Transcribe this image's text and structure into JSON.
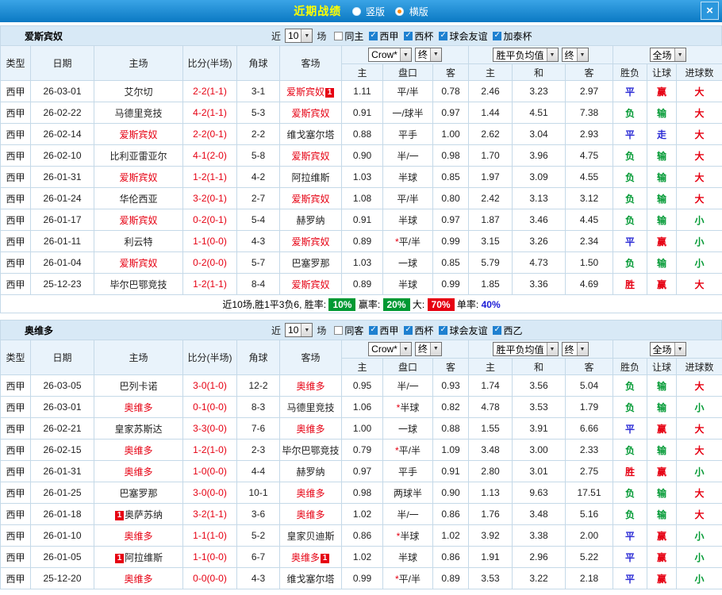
{
  "titlebar": {
    "title": "近期战绩",
    "layout_options": [
      {
        "label": "竖版",
        "selected": false
      },
      {
        "label": "横版",
        "selected": true
      }
    ],
    "close_label": "×"
  },
  "colors": {
    "accent_red": "#e60012",
    "accent_green": "#009933",
    "accent_blue": "#2b2bd5",
    "value_colors": {
      "胜": "#e60012",
      "平": "#2b2bd5",
      "负": "#009933",
      "赢": "#e60012",
      "输": "#009933",
      "走": "#2b2bd5",
      "大": "#e60012",
      "小": "#009933"
    }
  },
  "table_headers": {
    "left": [
      "类型",
      "日期",
      "主场",
      "比分(半场)",
      "角球",
      "客场"
    ],
    "odds_sub": [
      "主",
      "盘口",
      "客"
    ],
    "europe_sub": [
      "主",
      "和",
      "客"
    ],
    "result_sub": [
      "胜负",
      "让球",
      "进球数"
    ]
  },
  "sections": [
    {
      "team": "爱斯宾奴",
      "filter": {
        "near": "近",
        "count": "10",
        "unit": "场",
        "checkboxes": [
          {
            "label": "同主",
            "checked": false
          },
          {
            "label": "西甲",
            "checked": true
          },
          {
            "label": "西杯",
            "checked": true
          },
          {
            "label": "球会友谊",
            "checked": true
          },
          {
            "label": "加泰杯",
            "checked": true
          }
        ]
      },
      "selects": {
        "odds": "Crow*",
        "odds_stage": "终",
        "europe": "胜平负均值",
        "europe_stage": "终",
        "scope": "全场"
      },
      "rows": [
        {
          "league": "西甲",
          "date": "26-03-01",
          "home": "艾尔切",
          "home_badge": "",
          "score": "2-2(1-1)",
          "corner": "3-1",
          "away": "爱斯宾奴",
          "away_badge": "1",
          "odds": [
            "1.11",
            "平/半",
            "0.78"
          ],
          "europe": [
            "2.46",
            "3.23",
            "2.97"
          ],
          "result": [
            "平",
            "赢",
            "大"
          ]
        },
        {
          "league": "西甲",
          "date": "26-02-22",
          "home": "马德里竞技",
          "home_badge": "",
          "score": "4-2(1-1)",
          "corner": "5-3",
          "away": "爱斯宾奴",
          "away_badge": "",
          "odds": [
            "0.91",
            "一/球半",
            "0.97"
          ],
          "europe": [
            "1.44",
            "4.51",
            "7.38"
          ],
          "result": [
            "负",
            "输",
            "大"
          ]
        },
        {
          "league": "西甲",
          "date": "26-02-14",
          "home": "爱斯宾奴",
          "home_badge": "",
          "score": "2-2(0-1)",
          "corner": "2-2",
          "away": "维戈塞尔塔",
          "away_badge": "",
          "odds": [
            "0.88",
            "平手",
            "1.00"
          ],
          "europe": [
            "2.62",
            "3.04",
            "2.93"
          ],
          "result": [
            "平",
            "走",
            "大"
          ]
        },
        {
          "league": "西甲",
          "date": "26-02-10",
          "home": "比利亚雷亚尔",
          "home_badge": "",
          "score": "4-1(2-0)",
          "corner": "5-8",
          "away": "爱斯宾奴",
          "away_badge": "",
          "odds": [
            "0.90",
            "半/一",
            "0.98"
          ],
          "europe": [
            "1.70",
            "3.96",
            "4.75"
          ],
          "result": [
            "负",
            "输",
            "大"
          ]
        },
        {
          "league": "西甲",
          "date": "26-01-31",
          "home": "爱斯宾奴",
          "home_badge": "",
          "score": "1-2(1-1)",
          "corner": "4-2",
          "away": "阿拉维斯",
          "away_badge": "",
          "odds": [
            "1.03",
            "半球",
            "0.85"
          ],
          "europe": [
            "1.97",
            "3.09",
            "4.55"
          ],
          "result": [
            "负",
            "输",
            "大"
          ]
        },
        {
          "league": "西甲",
          "date": "26-01-24",
          "home": "华伦西亚",
          "home_badge": "",
          "score": "3-2(0-1)",
          "corner": "2-7",
          "away": "爱斯宾奴",
          "away_badge": "",
          "odds": [
            "1.08",
            "平/半",
            "0.80"
          ],
          "europe": [
            "2.42",
            "3.13",
            "3.12"
          ],
          "result": [
            "负",
            "输",
            "大"
          ]
        },
        {
          "league": "西甲",
          "date": "26-01-17",
          "home": "爱斯宾奴",
          "home_badge": "",
          "score": "0-2(0-1)",
          "corner": "5-4",
          "away": "赫罗纳",
          "away_badge": "",
          "odds": [
            "0.91",
            "半球",
            "0.97"
          ],
          "europe": [
            "1.87",
            "3.46",
            "4.45"
          ],
          "result": [
            "负",
            "输",
            "小"
          ]
        },
        {
          "league": "西甲",
          "date": "26-01-11",
          "home": "利云特",
          "home_badge": "",
          "score": "1-1(0-0)",
          "corner": "4-3",
          "away": "爱斯宾奴",
          "away_badge": "",
          "odds": [
            "0.89",
            "*平/半",
            "0.99"
          ],
          "europe": [
            "3.15",
            "3.26",
            "2.34"
          ],
          "result": [
            "平",
            "赢",
            "小"
          ]
        },
        {
          "league": "西甲",
          "date": "26-01-04",
          "home": "爱斯宾奴",
          "home_badge": "",
          "score": "0-2(0-0)",
          "corner": "5-7",
          "away": "巴塞罗那",
          "away_badge": "",
          "odds": [
            "1.03",
            "一球",
            "0.85"
          ],
          "europe": [
            "5.79",
            "4.73",
            "1.50"
          ],
          "result": [
            "负",
            "输",
            "小"
          ]
        },
        {
          "league": "西甲",
          "date": "25-12-23",
          "home": "毕尔巴鄂竞技",
          "home_badge": "",
          "score": "1-2(1-1)",
          "corner": "8-4",
          "away": "爱斯宾奴",
          "away_badge": "",
          "odds": [
            "0.89",
            "半球",
            "0.99"
          ],
          "europe": [
            "1.85",
            "3.36",
            "4.69"
          ],
          "result": [
            "胜",
            "赢",
            "大"
          ]
        }
      ],
      "summary": {
        "prefix": "近10场,胜1平3负6,",
        "items": [
          {
            "label": "胜率:",
            "value": "10%",
            "bg": "#009933"
          },
          {
            "label": "赢率:",
            "value": "20%",
            "bg": "#009933"
          },
          {
            "label": "大:",
            "value": "70%",
            "bg": "#e60012"
          },
          {
            "label": "单率:",
            "value": "40%",
            "bg": ""
          }
        ]
      }
    },
    {
      "team": "奥维多",
      "filter": {
        "near": "近",
        "count": "10",
        "unit": "场",
        "checkboxes": [
          {
            "label": "同客",
            "checked": false
          },
          {
            "label": "西甲",
            "checked": true
          },
          {
            "label": "西杯",
            "checked": true
          },
          {
            "label": "球会友谊",
            "checked": true
          },
          {
            "label": "西乙",
            "checked": true
          }
        ]
      },
      "selects": {
        "odds": "Crow*",
        "odds_stage": "终",
        "europe": "胜平负均值",
        "europe_stage": "终",
        "scope": "全场"
      },
      "rows": [
        {
          "league": "西甲",
          "date": "26-03-05",
          "home": "巴列卡诺",
          "home_badge": "",
          "score": "3-0(1-0)",
          "corner": "12-2",
          "away": "奥维多",
          "away_badge": "",
          "odds": [
            "0.95",
            "半/一",
            "0.93"
          ],
          "europe": [
            "1.74",
            "3.56",
            "5.04"
          ],
          "result": [
            "负",
            "输",
            "大"
          ]
        },
        {
          "league": "西甲",
          "date": "26-03-01",
          "home": "奥维多",
          "home_badge": "",
          "score": "0-1(0-0)",
          "corner": "8-3",
          "away": "马德里竞技",
          "away_badge": "",
          "odds": [
            "1.06",
            "*半球",
            "0.82"
          ],
          "europe": [
            "4.78",
            "3.53",
            "1.79"
          ],
          "result": [
            "负",
            "输",
            "小"
          ]
        },
        {
          "league": "西甲",
          "date": "26-02-21",
          "home": "皇家苏斯达",
          "home_badge": "",
          "score": "3-3(0-0)",
          "corner": "7-6",
          "away": "奥维多",
          "away_badge": "",
          "odds": [
            "1.00",
            "一球",
            "0.88"
          ],
          "europe": [
            "1.55",
            "3.91",
            "6.66"
          ],
          "result": [
            "平",
            "赢",
            "大"
          ]
        },
        {
          "league": "西甲",
          "date": "26-02-15",
          "home": "奥维多",
          "home_badge": "",
          "score": "1-2(1-0)",
          "corner": "2-3",
          "away": "毕尔巴鄂竞技",
          "away_badge": "",
          "odds": [
            "0.79",
            "*平/半",
            "1.09"
          ],
          "europe": [
            "3.48",
            "3.00",
            "2.33"
          ],
          "result": [
            "负",
            "输",
            "大"
          ]
        },
        {
          "league": "西甲",
          "date": "26-01-31",
          "home": "奥维多",
          "home_badge": "",
          "score": "1-0(0-0)",
          "corner": "4-4",
          "away": "赫罗纳",
          "away_badge": "",
          "odds": [
            "0.97",
            "平手",
            "0.91"
          ],
          "europe": [
            "2.80",
            "3.01",
            "2.75"
          ],
          "result": [
            "胜",
            "赢",
            "小"
          ]
        },
        {
          "league": "西甲",
          "date": "26-01-25",
          "home": "巴塞罗那",
          "home_badge": "",
          "score": "3-0(0-0)",
          "corner": "10-1",
          "away": "奥维多",
          "away_badge": "",
          "odds": [
            "0.98",
            "两球半",
            "0.90"
          ],
          "europe": [
            "1.13",
            "9.63",
            "17.51"
          ],
          "result": [
            "负",
            "输",
            "大"
          ]
        },
        {
          "league": "西甲",
          "date": "26-01-18",
          "home": "奥萨苏纳",
          "home_badge": "1",
          "score": "3-2(1-1)",
          "corner": "3-6",
          "away": "奥维多",
          "away_badge": "",
          "odds": [
            "1.02",
            "半/一",
            "0.86"
          ],
          "europe": [
            "1.76",
            "3.48",
            "5.16"
          ],
          "result": [
            "负",
            "输",
            "大"
          ]
        },
        {
          "league": "西甲",
          "date": "26-01-10",
          "home": "奥维多",
          "home_badge": "",
          "score": "1-1(1-0)",
          "corner": "5-2",
          "away": "皇家贝迪斯",
          "away_badge": "",
          "odds": [
            "0.86",
            "*半球",
            "1.02"
          ],
          "europe": [
            "3.92",
            "3.38",
            "2.00"
          ],
          "result": [
            "平",
            "赢",
            "小"
          ]
        },
        {
          "league": "西甲",
          "date": "26-01-05",
          "home": "阿拉维斯",
          "home_badge": "1",
          "score": "1-1(0-0)",
          "corner": "6-7",
          "away": "奥维多",
          "away_badge": "1",
          "odds": [
            "1.02",
            "半球",
            "0.86"
          ],
          "europe": [
            "1.91",
            "2.96",
            "5.22"
          ],
          "result": [
            "平",
            "赢",
            "小"
          ]
        },
        {
          "league": "西甲",
          "date": "25-12-20",
          "home": "奥维多",
          "home_badge": "",
          "score": "0-0(0-0)",
          "corner": "4-3",
          "away": "维戈塞尔塔",
          "away_badge": "",
          "odds": [
            "0.99",
            "*平/半",
            "0.89"
          ],
          "europe": [
            "3.53",
            "3.22",
            "2.18"
          ],
          "result": [
            "平",
            "赢",
            "小"
          ]
        }
      ],
      "summary": null
    }
  ]
}
